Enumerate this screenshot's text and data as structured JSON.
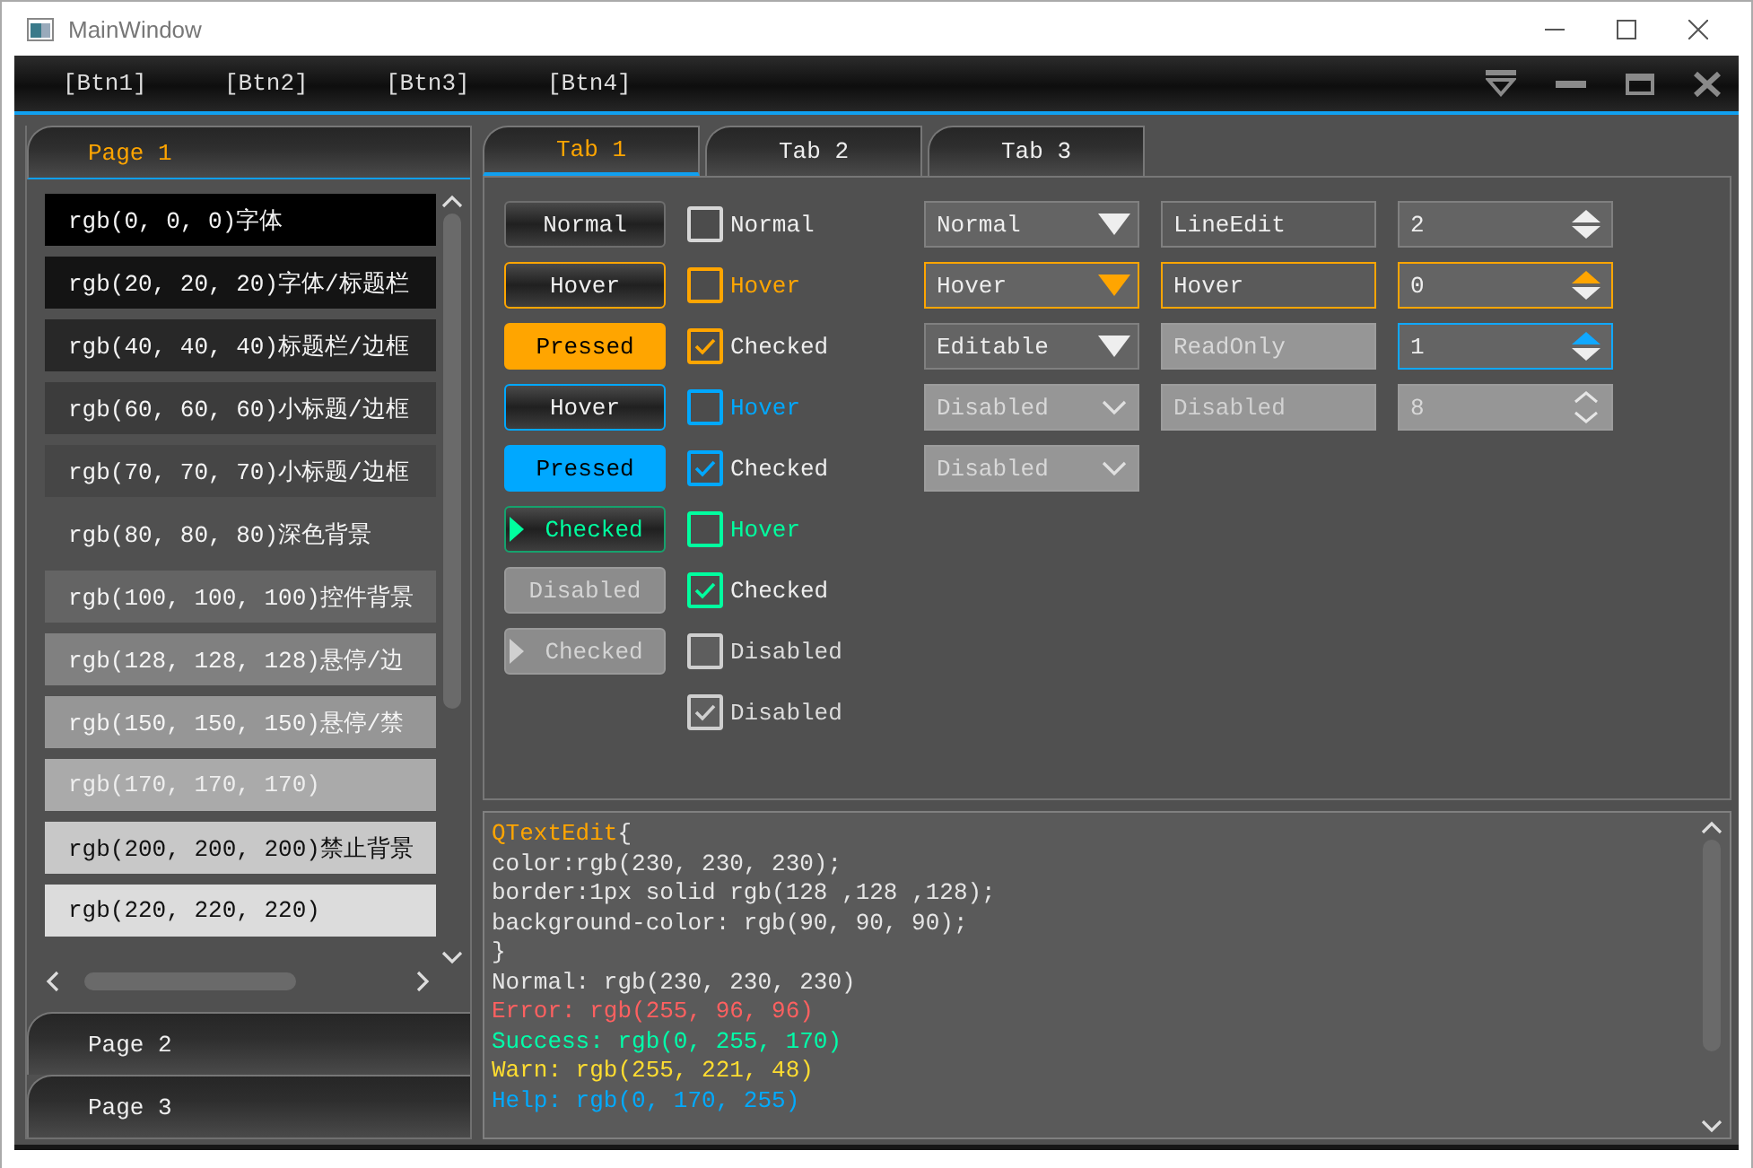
{
  "window": {
    "title": "MainWindow"
  },
  "toolbar": {
    "buttons": [
      "[Btn1]",
      "[Btn2]",
      "[Btn3]",
      "[Btn4]"
    ]
  },
  "toolbox": {
    "pages": [
      {
        "label": "Page 1",
        "selected": true
      },
      {
        "label": "Page 2",
        "selected": false
      },
      {
        "label": "Page 3",
        "selected": false
      }
    ],
    "colors": [
      {
        "text": "rgb(0, 0, 0)字体",
        "color": "#000000"
      },
      {
        "text": "rgb(20, 20, 20)字体/标题栏",
        "color": "#141414"
      },
      {
        "text": "rgb(40, 40, 40)标题栏/边框",
        "color": "#282828"
      },
      {
        "text": "rgb(60, 60, 60)小标题/边框",
        "color": "#3c3c3c"
      },
      {
        "text": "rgb(70, 70, 70)小标题/边框",
        "color": "#464646"
      },
      {
        "text": "rgb(80, 80, 80)深色背景",
        "color": "#505050"
      },
      {
        "text": "rgb(100, 100, 100)控件背景",
        "color": "#646464"
      },
      {
        "text": "rgb(128, 128, 128)悬停/边",
        "color": "#808080"
      },
      {
        "text": "rgb(150, 150, 150)悬停/禁",
        "color": "#969696"
      },
      {
        "text": "rgb(170, 170, 170)",
        "color": "#aaaaaa"
      },
      {
        "text": "rgb(200, 200, 200)禁止背景",
        "color": "#c8c8c8"
      },
      {
        "text": "rgb(220, 220, 220)",
        "color": "#dcdcdc"
      }
    ]
  },
  "tabs": [
    {
      "label": "Tab 1",
      "selected": true
    },
    {
      "label": "Tab 2",
      "selected": false
    },
    {
      "label": "Tab 3",
      "selected": false
    }
  ],
  "buttons": [
    {
      "label": "Normal",
      "hovered": false,
      "pressed": false,
      "disabled": false,
      "checked": false
    },
    {
      "label": "Hover",
      "hovered": true,
      "pressed": false,
      "disabled": false,
      "checked": false,
      "color": "#ffa500"
    },
    {
      "label": "Pressed",
      "hovered": false,
      "pressed": true,
      "disabled": false,
      "checked": false,
      "color": "#ffa500"
    },
    {
      "label": "Hover",
      "hovered": true,
      "pressed": false,
      "disabled": false,
      "checked": false,
      "color": "#00a8ff"
    },
    {
      "label": "Pressed",
      "hovered": false,
      "pressed": true,
      "disabled": false,
      "checked": false,
      "color": "#00a8ff"
    },
    {
      "label": "Checked",
      "hovered": false,
      "pressed": false,
      "disabled": false,
      "checked": true,
      "color": "#00ff9f"
    },
    {
      "label": "Disabled",
      "hovered": false,
      "pressed": false,
      "disabled": true,
      "checked": false
    },
    {
      "label": "Checked",
      "hovered": false,
      "pressed": false,
      "disabled": true,
      "checked": true
    }
  ],
  "checkboxes": [
    {
      "label": "Normal",
      "hovered": false,
      "disabled": false,
      "checked": false
    },
    {
      "label": "Hover",
      "hovered": true,
      "disabled": false,
      "checked": false,
      "color": "#ffa500"
    },
    {
      "label": "Checked",
      "hovered": false,
      "disabled": false,
      "checked": true,
      "color": "#ffa500"
    },
    {
      "label": "Hover",
      "hovered": true,
      "disabled": false,
      "checked": false,
      "color": "#00a8ff"
    },
    {
      "label": "Checked",
      "hovered": false,
      "disabled": false,
      "checked": true,
      "color": "#00a8ff"
    },
    {
      "label": "Hover",
      "hovered": true,
      "disabled": false,
      "checked": false,
      "color": "#00ff9f"
    },
    {
      "label": "Checked",
      "hovered": false,
      "disabled": false,
      "checked": true,
      "color": "#00ff9f"
    },
    {
      "label": "Disabled",
      "hovered": false,
      "disabled": true,
      "checked": false
    },
    {
      "label": "Disabled",
      "hovered": false,
      "disabled": true,
      "checked": true
    }
  ],
  "combos": [
    {
      "value": "Normal",
      "hovered": false,
      "disabled": false
    },
    {
      "value": "Hover",
      "hovered": true,
      "disabled": false
    },
    {
      "value": "Editable",
      "hovered": false,
      "disabled": false
    },
    {
      "value": "Disabled",
      "hovered": false,
      "disabled": true
    },
    {
      "value": "Disabled",
      "hovered": false,
      "disabled": true
    }
  ],
  "line_edits": [
    {
      "value": "LineEdit",
      "hovered": false,
      "read_only": false,
      "disabled": false
    },
    {
      "value": "Hover",
      "hovered": true,
      "read_only": false,
      "disabled": false
    },
    {
      "value": "ReadOnly",
      "hovered": false,
      "read_only": true,
      "disabled": false
    },
    {
      "value": "Disabled",
      "hovered": false,
      "read_only": false,
      "disabled": true
    }
  ],
  "spin_boxes": [
    {
      "value": "2",
      "hovered": false,
      "focused": false,
      "disabled": false
    },
    {
      "value": "0",
      "hovered": true,
      "focused": false,
      "disabled": false
    },
    {
      "value": "1",
      "hovered": false,
      "focused": true,
      "disabled": false
    },
    {
      "value": "8",
      "hovered": false,
      "focused": false,
      "disabled": true
    }
  ],
  "text_edit": {
    "lines": [
      {
        "segments": [
          {
            "text": "QTextEdit",
            "color": "#ffa500"
          },
          {
            "text": "{",
            "color": "#e6e6e6"
          }
        ]
      },
      {
        "segments": [
          {
            "text": "color:rgb(230, 230, 230);",
            "color": "#e6e6e6"
          }
        ]
      },
      {
        "segments": [
          {
            "text": "border:1px solid rgb(128 ,128 ,128);",
            "color": "#e6e6e6"
          }
        ]
      },
      {
        "segments": [
          {
            "text": "background-color: rgb(90, 90, 90);",
            "color": "#e6e6e6"
          }
        ]
      },
      {
        "segments": [
          {
            "text": "}",
            "color": "#e6e6e6"
          }
        ]
      },
      {
        "segments": [
          {
            "text": "Normal: rgb(230, 230, 230)",
            "color": "#e6e6e6"
          }
        ]
      },
      {
        "segments": [
          {
            "text": "Error: rgb(255, 96, 96)",
            "color": "#ff6060"
          }
        ]
      },
      {
        "segments": [
          {
            "text": "Success: rgb(0, 255, 170)",
            "color": "#00ffaa"
          }
        ]
      },
      {
        "segments": [
          {
            "text": "Warn: rgb(255, 221, 48)",
            "color": "#ffdd30"
          }
        ]
      },
      {
        "segments": [
          {
            "text": "Help: rgb(0, 170, 255)",
            "color": "#00aaff"
          }
        ]
      }
    ]
  }
}
